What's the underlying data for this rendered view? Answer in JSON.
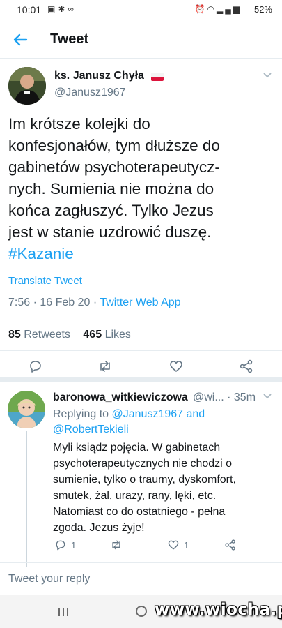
{
  "status_bar": {
    "time": "10:01",
    "left_icons": [
      "camera-icon",
      "snowflake-icon",
      "link-icon"
    ],
    "right_icons": [
      "alarm-icon",
      "wifi-icon",
      "signal-icon"
    ],
    "battery": "52%"
  },
  "header": {
    "title": "Tweet",
    "back_icon": "arrow-left-icon"
  },
  "tweet": {
    "author_name": "ks. Janusz Chyła",
    "author_handle": "@Janusz1967",
    "flag_icon": "poland-flag-icon",
    "text_lines": [
      "Im krótsze kolejki do",
      "konfesjonałów, tym dłuższe do",
      "gabinetów psychoterapeutycz-",
      "nych. Sumienia nie można do",
      "końca zagłuszyć. Tylko Jezus",
      "jest w stanie uzdrowić duszę."
    ],
    "hashtag": "#Kazanie",
    "translate_label": "Translate Tweet",
    "time_date": "7:56 · 16 Feb 20 · ",
    "source_app": "Twitter Web App",
    "retweets_count": "85",
    "retweets_label": "Retweets",
    "likes_count": "465",
    "likes_label": "Likes",
    "actions": [
      "reply-icon",
      "retweet-icon",
      "like-icon",
      "share-icon"
    ]
  },
  "reply": {
    "author_name": "baronowa_witkiewiczowa",
    "author_handle": "@wi... · 35m",
    "replying_prefix": "Replying to ",
    "mention_1": "@Janusz1967",
    "and_word": " and",
    "mention_2": "@RobertTekieli",
    "text_lines": [
      "Myli ksiądz pojęcia. W gabinetach",
      "psychoterapeutycznych nie chodzi o",
      "sumienie, tylko o traumy, dyskomfort,",
      "smutek, żal, urazy, rany, lęki, etc.",
      "Natomiast co do ostatniego - pełna",
      "zgoda. Jezus żyje!"
    ],
    "reply_count": "1",
    "retweet_count": "",
    "like_count": "1"
  },
  "compose": {
    "placeholder": "Tweet your reply"
  },
  "nav": {
    "recent_icon": "recent-apps-icon",
    "home_icon": "home-icon"
  },
  "watermark": "www.wiocha.pl",
  "colors": {
    "accent": "#1da1f2",
    "secondary_text": "#657786",
    "primary_text": "#14171a",
    "divider": "#e6ecf0"
  }
}
